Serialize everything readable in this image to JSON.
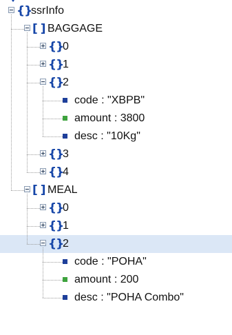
{
  "tree": [
    {
      "key": "ssrInfo",
      "kind": "object",
      "depth": 0,
      "expanded": true
    },
    {
      "key": "BAGGAGE",
      "kind": "array",
      "depth": 1,
      "expanded": true
    },
    {
      "key": "0",
      "kind": "object",
      "depth": 2,
      "expanded": false
    },
    {
      "key": "1",
      "kind": "object",
      "depth": 2,
      "expanded": false
    },
    {
      "key": "2",
      "kind": "object",
      "depth": 2,
      "expanded": true
    },
    {
      "key": "code",
      "kind": "string",
      "depth": 3,
      "value": "\"XBPB\""
    },
    {
      "key": "amount",
      "kind": "number",
      "depth": 3,
      "value": "3800"
    },
    {
      "key": "desc",
      "kind": "string",
      "depth": 3,
      "value": "\"10Kg\""
    },
    {
      "key": "3",
      "kind": "object",
      "depth": 2,
      "expanded": false
    },
    {
      "key": "4",
      "kind": "object",
      "depth": 2,
      "expanded": false
    },
    {
      "key": "MEAL",
      "kind": "array",
      "depth": 1,
      "expanded": true
    },
    {
      "key": "0",
      "kind": "object",
      "depth": 2,
      "expanded": false
    },
    {
      "key": "1",
      "kind": "object",
      "depth": 2,
      "expanded": false
    },
    {
      "key": "2",
      "kind": "object",
      "depth": 2,
      "expanded": true,
      "selected": true
    },
    {
      "key": "code",
      "kind": "string",
      "depth": 3,
      "value": "\"POHA\""
    },
    {
      "key": "amount",
      "kind": "number",
      "depth": 3,
      "value": "200"
    },
    {
      "key": "desc",
      "kind": "string",
      "depth": 3,
      "value": "\"POHA Combo\""
    }
  ],
  "separator": " : ",
  "glyphs": {
    "object": "{}",
    "array": "[ ]"
  },
  "icons": {
    "object": "object-braces-icon",
    "array": "array-brackets-icon",
    "string": "string-value-icon",
    "number": "number-value-icon",
    "expanded": "collapse-minus-icon",
    "collapsed": "expand-plus-icon"
  },
  "colors": {
    "glyph": "#1646a8",
    "string_leaf": "#1e3f9a",
    "number_leaf": "#3ea33e",
    "selected_row": "#dbe7f6",
    "tree_lines": "#9c9c9c"
  }
}
